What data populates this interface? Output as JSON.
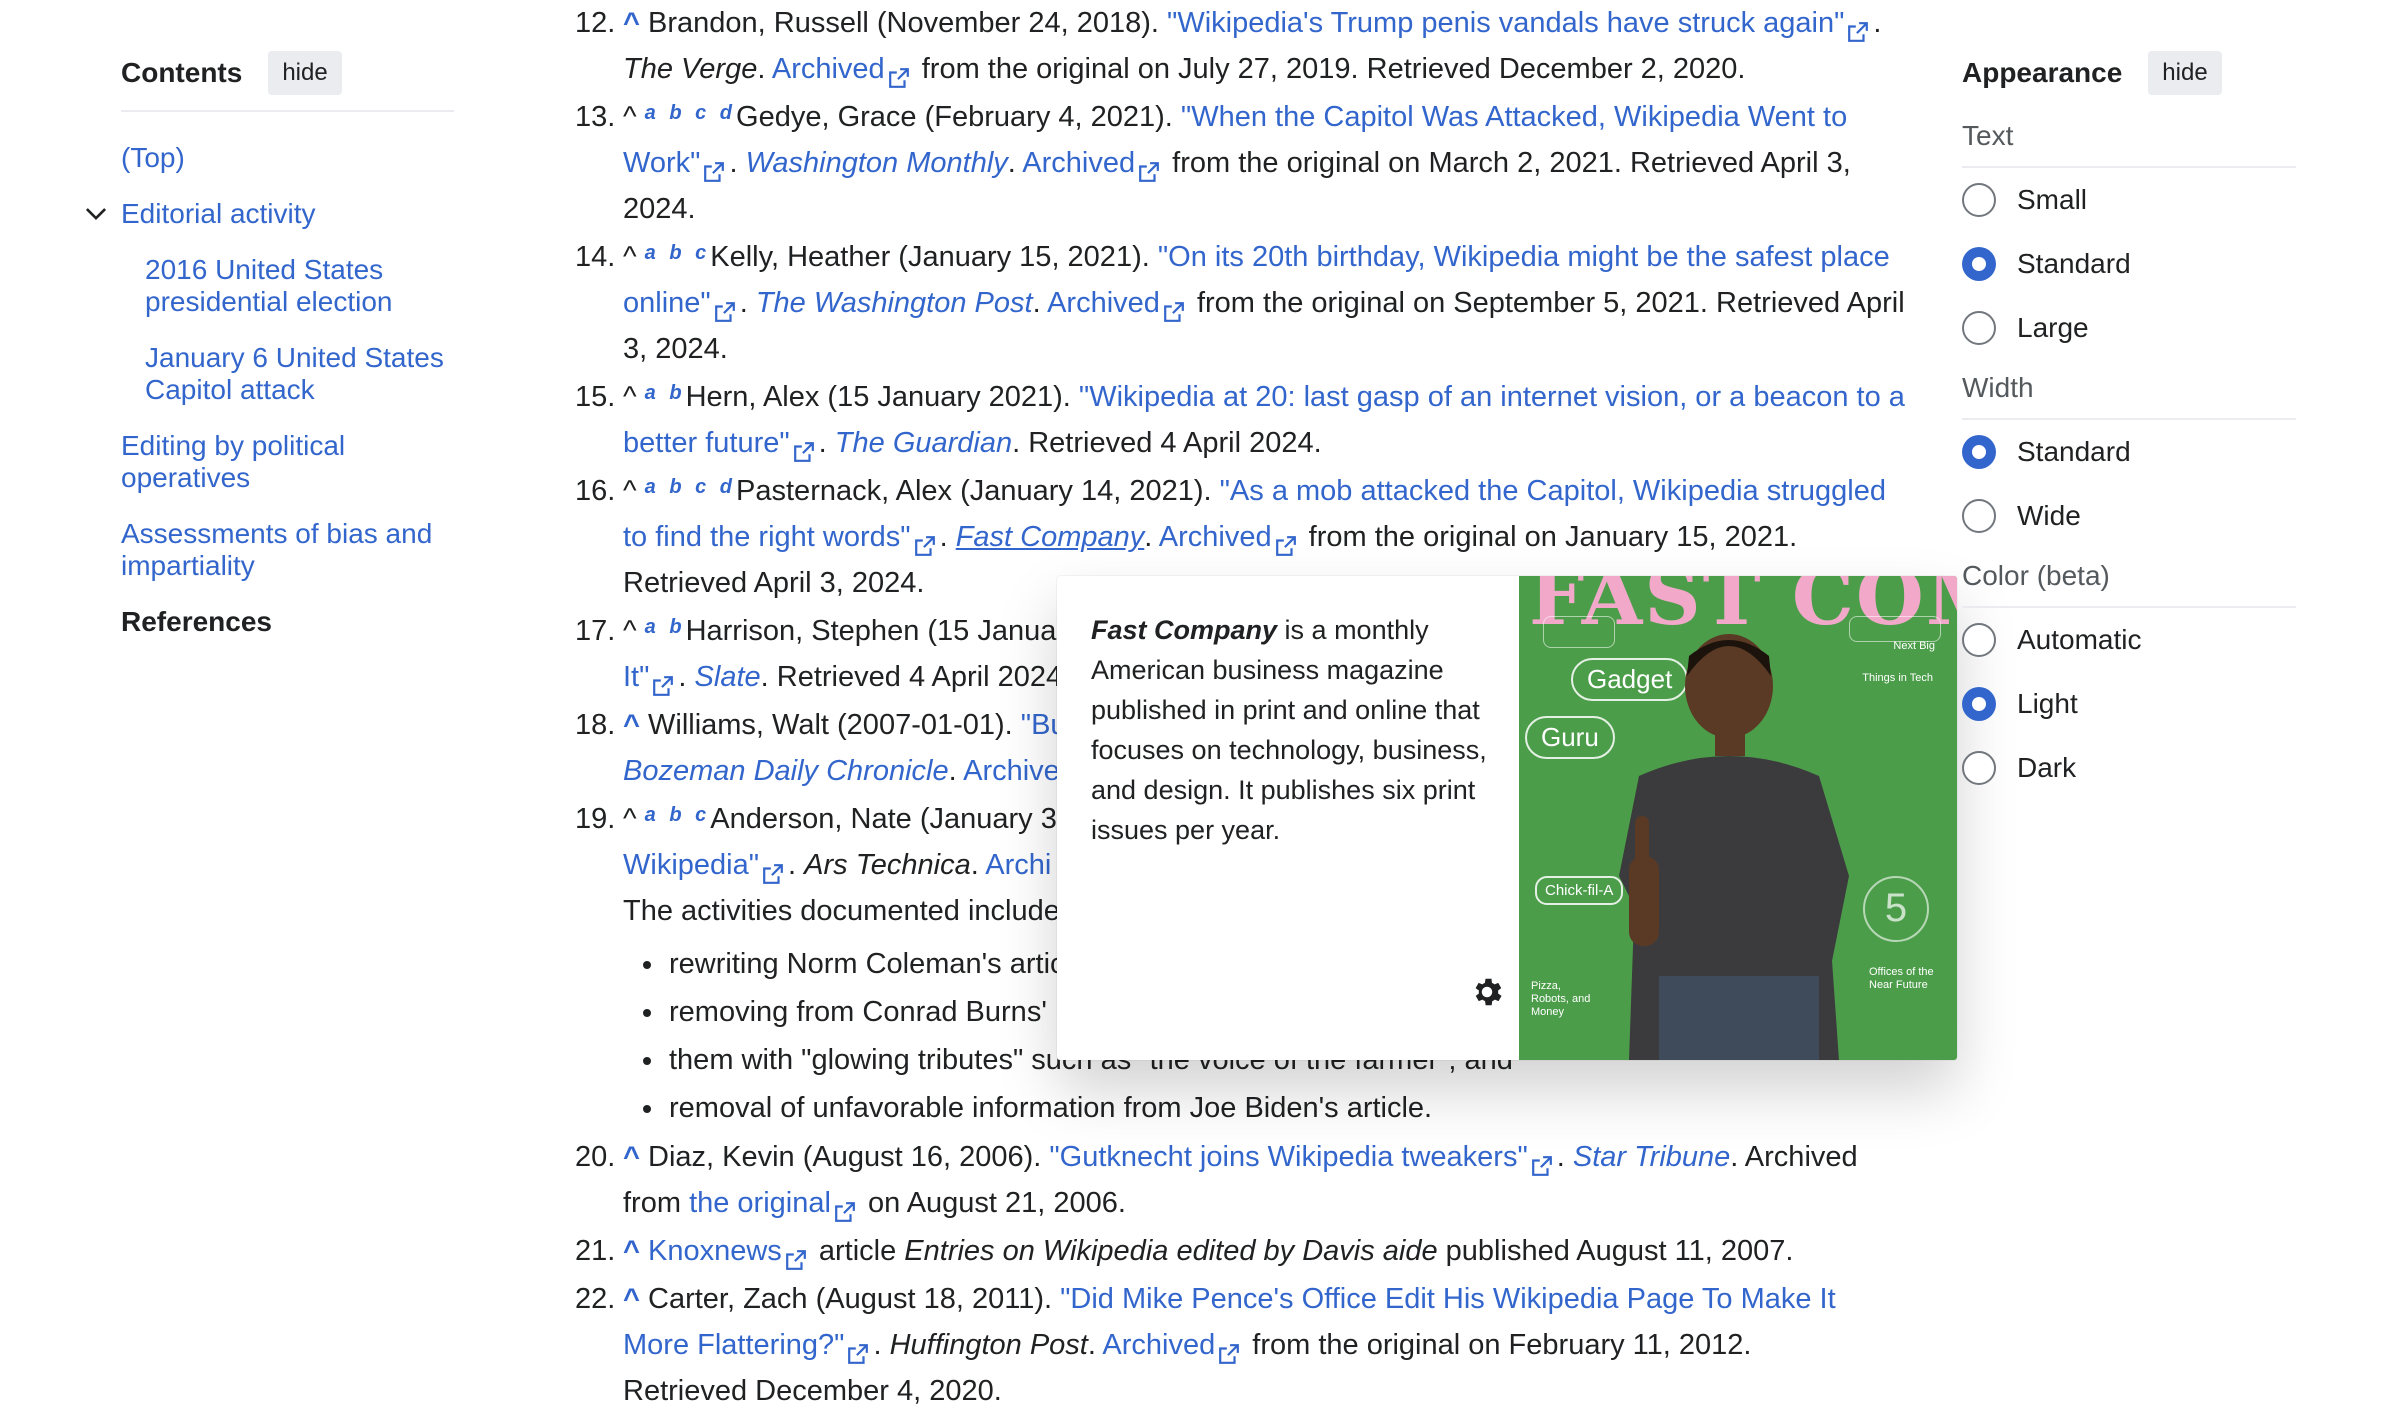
{
  "toc": {
    "title": "Contents",
    "hide_label": "hide",
    "items": [
      {
        "label": "(Top)"
      },
      {
        "label": "Editorial activity"
      },
      {
        "label": "2016 United States presidential election"
      },
      {
        "label": "January 6 United States Capitol attack"
      },
      {
        "label": "Editing by political operatives"
      },
      {
        "label": "Assessments of bias and impartiality"
      },
      {
        "label": "References"
      }
    ]
  },
  "appearance": {
    "title": "Appearance",
    "hide_label": "hide",
    "text_label": "Text",
    "text_options": [
      "Small",
      "Standard",
      "Large"
    ],
    "text_selected": "Standard",
    "width_label": "Width",
    "width_options": [
      "Standard",
      "Wide"
    ],
    "width_selected": "Standard",
    "color_label": "Color (beta)",
    "color_options": [
      "Automatic",
      "Light",
      "Dark"
    ],
    "color_selected": "Light"
  },
  "refs": {
    "r12": {
      "num": "12.",
      "caret": "^",
      "a": "Brandon, Russell (November 24, 2018). ",
      "title": "\"Wikipedia's Trump penis vandals have struck again\"",
      "b": ". ",
      "work": "The Verge",
      "c": ". ",
      "archived": "Archived",
      "d": " from the original on July 27, 2019. Retrieved December 2, 2020."
    },
    "r13": {
      "num": "13.",
      "caret": "^",
      "backs": "a b c d",
      "a": "Gedye, Grace (February 4, 2021). ",
      "title": "\"When the Capitol Was Attacked, Wikipedia Went to Work\"",
      "b": ". ",
      "work": "Washington Monthly",
      "c": ". ",
      "archived": "Archived",
      "d": " from the original on March 2, 2021. Retrieved April 3, 2024."
    },
    "r14": {
      "num": "14.",
      "caret": "^",
      "backs": "a b c",
      "a": "Kelly, Heather (January 15, 2021). ",
      "title": "\"On its 20th birthday, Wikipedia might be the safest place online\"",
      "b": ". ",
      "work": "The Washington Post",
      "c": ". ",
      "archived": "Archived",
      "d": " from the original on September 5, 2021. Retrieved April 3, 2024."
    },
    "r15": {
      "num": "15.",
      "caret": "^",
      "backs": "a b",
      "a": "Hern, Alex (15 January 2021). ",
      "title": "\"Wikipedia at 20: last gasp of an internet vision, or a beacon to a better future\"",
      "b": ". ",
      "work": "The Guardian",
      "d": ". Retrieved 4 April 2024."
    },
    "r16": {
      "num": "16.",
      "caret": "^",
      "backs": "a b c d",
      "a": "Pasternack, Alex (January 14, 2021). ",
      "title": "\"As a mob attacked the Capitol, Wikipedia struggled to find the right words\"",
      "b": ". ",
      "work": "Fast Company",
      "c": ". ",
      "archived": "Archived",
      "d": " from the original on January 15, 2021. Retrieved April 3, 2024."
    },
    "r17": {
      "num": "17.",
      "caret": "^",
      "backs": "a b",
      "a": "Harrison, Stephen (15 Janua",
      "title2": "It\"",
      "b": ". ",
      "work": "Slate",
      "d": ". Retrieved 4 April 2024"
    },
    "r18": {
      "num": "18.",
      "caret": "^",
      "a": "Williams, Walt (2007-01-01). ",
      "title": "\"Bu",
      "work": "Bozeman Daily Chronicle",
      "c": ". ",
      "archived": "Archive"
    },
    "r19": {
      "num": "19.",
      "caret": "^",
      "backs": "a b c",
      "a": "Anderson, Nate (January 3",
      "title2": "Wikipedia\"",
      "b": ". ",
      "work": "Ars Technica",
      "c": ". ",
      "archived": "Archi",
      "d2": "The activities documented include",
      "bullets": [
        "rewriting Norm Coleman's artic",
        "removing from Conrad Burns'",
        "them with \"glowing tributes\" such as \"the voice of the farmer\"; and",
        "removal of unfavorable information from Joe Biden's article."
      ]
    },
    "r20": {
      "num": "20.",
      "caret": "^",
      "a": "Diaz, Kevin (August 16, 2006). ",
      "title": "\"Gutknecht joins Wikipedia tweakers\"",
      "b": ". ",
      "work": "Star Tribune",
      "c": ". Archived from ",
      "orig": "the original",
      "d": " on August 21, 2006."
    },
    "r21": {
      "num": "21.",
      "caret": "^",
      "title": "Knoxnews",
      "a": " article ",
      "work": "Entries on Wikipedia edited by Davis aide",
      "d": " published August 11, 2007."
    },
    "r22": {
      "num": "22.",
      "caret": "^",
      "a": "Carter, Zach (August 18, 2011). ",
      "title": "\"Did Mike Pence's Office Edit His Wikipedia Page To Make It More Flattering?\"",
      "b": ". ",
      "work": "Huffington Post",
      "c": ". ",
      "archived": "Archived",
      "d": " from the original on February 11, 2012.",
      "e": "Retrieved December 4, 2020."
    }
  },
  "popup": {
    "bold": "Fast Company",
    "text": " is a monthly American business magazine published in print and online that focuses on technology, business, and design. It publishes six print issues per year.",
    "cover": {
      "title": "FAST COMPANY",
      "chips": [
        "Gadget",
        "Guru",
        "Chick-fil-A"
      ],
      "labels": [
        "Next Big",
        "Things in Tech",
        "Offices of the Near Future",
        "Pizza, Robots, and Money",
        "5"
      ],
      "bg_color": "#4c9d4a",
      "title_color": "#f2a9c9"
    }
  }
}
